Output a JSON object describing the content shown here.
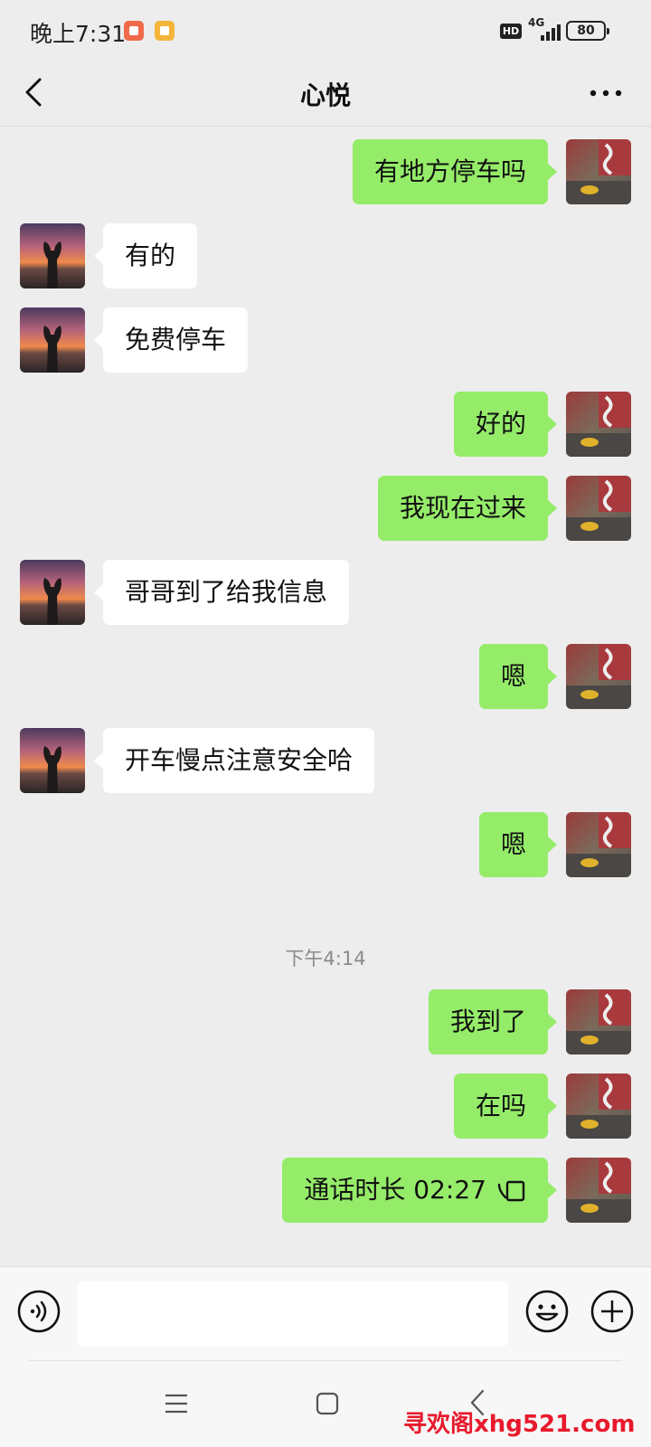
{
  "status_bar": {
    "time": "晚上7:31",
    "hd_badge": "HD",
    "network": "4G",
    "battery": "80"
  },
  "header": {
    "title": "心悦"
  },
  "messages": [
    {
      "sender": "self",
      "text": "有地方停车吗"
    },
    {
      "sender": "other",
      "text": "有的"
    },
    {
      "sender": "other",
      "text": "免费停车"
    },
    {
      "sender": "self",
      "text": "好的"
    },
    {
      "sender": "self",
      "text": "我现在过来"
    },
    {
      "sender": "other",
      "text": "哥哥到了给我信息"
    },
    {
      "sender": "self",
      "text": "嗯"
    },
    {
      "sender": "other",
      "text": "开车慢点注意安全哈"
    },
    {
      "sender": "self",
      "text": "嗯"
    },
    {
      "sender": "self",
      "text": "我到了"
    },
    {
      "sender": "self",
      "text": "在吗"
    },
    {
      "sender": "self",
      "text": "通话时长 02:27",
      "type": "call"
    }
  ],
  "timestamp": "下午4:14",
  "input": {
    "value": "",
    "placeholder": ""
  },
  "watermark": "寻欢阁xhg521.com",
  "icons": {
    "back": "chevron-left-icon",
    "more": "more-dots-icon",
    "voice": "voice-icon",
    "emoji": "emoji-icon",
    "plus": "plus-icon",
    "call": "phone-call-icon"
  },
  "colors": {
    "self_bubble": "#95ec69",
    "other_bubble": "#ffffff",
    "background": "#ededed"
  }
}
